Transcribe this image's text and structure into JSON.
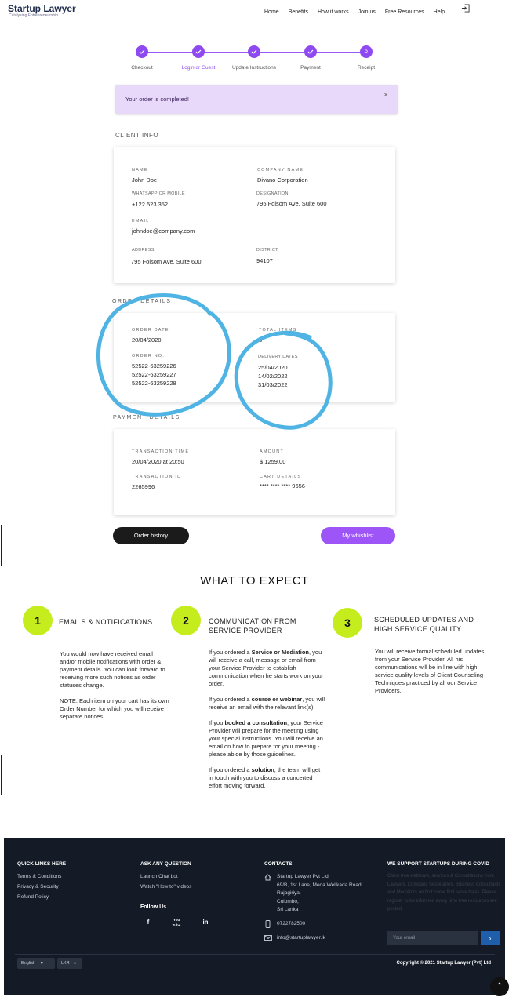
{
  "header": {
    "brand": "Startup Lawyer",
    "tagline": "Catalysing Entrepreneurship",
    "nav": [
      "Home",
      "Benefits",
      "How it works",
      "Join us",
      "Free Resources",
      "Help"
    ]
  },
  "steps": [
    {
      "label": "Checkout",
      "state": "done"
    },
    {
      "label": "Login or Guest",
      "state": "done"
    },
    {
      "label": "Update Instructions",
      "state": "done"
    },
    {
      "label": "Payment",
      "state": "done"
    },
    {
      "label": "Receipt",
      "state": "current",
      "number": "5"
    }
  ],
  "alert": {
    "message": "Your order is completed!",
    "close": "×"
  },
  "client_info": {
    "title": "CLIENT INFO",
    "name_label": "NAME",
    "name": "John Doe",
    "company_label": "COMPANY NAME",
    "company": "Divano Corporation",
    "phone_label": "WHATSAPP OR MOBILE",
    "phone": "+122 523 352",
    "designation_label": "DESIGNATION",
    "designation": "795 Folsom Ave, Suite 600",
    "email_label": "EMAIL",
    "email": "johndoe@company.com",
    "address_label": "ADDRESS",
    "address": "795 Folsom Ave, Suite 600",
    "district_label": "DISTRICT",
    "district": "94107"
  },
  "order_details": {
    "title": "ORDER DETAILS",
    "date_label": "ORDER DATE",
    "date": "20/04/2020",
    "items_label": "TOTAL ITEMS",
    "items": "3",
    "orderno_label": "ORDER NO.",
    "order_numbers": [
      "52522-63259226",
      "52522-63259227",
      "52522-63259228"
    ],
    "delivery_label": "DELIVERY DATES",
    "delivery_dates": [
      "25/04/2020",
      "14/02/2022",
      "31/03/2022"
    ]
  },
  "payment_details": {
    "title": "PAYMENT DETAILS",
    "time_label": "TRANSACTION TIME",
    "time": "20/04/2020 at 20:50",
    "amount_label": "AMOUNT",
    "amount": "$ 1259,00",
    "txid_label": "TRANSACTION ID",
    "txid": "2265996",
    "card_label": "CART DETAILS",
    "card": "**** **** **** 9656"
  },
  "buttons": {
    "order_history": "Order history",
    "wishlist": "My whishlist"
  },
  "what_to_expect": {
    "title": "WHAT TO EXPECT",
    "columns": [
      {
        "number": "1",
        "title": "EMAILS & NOTIFICATIONS",
        "paragraphs": [
          "You would now have received email and/or mobile notifications with order & payment details. You can look forward to receiving more such notices as order statuses change.",
          "NOTE: Each item on your cart has its own Order Number for which you will receive separate notices."
        ]
      },
      {
        "number": "2",
        "title": "COMMUNICATION FROM SERVICE PROVIDER",
        "p1_a": "If you ordered a ",
        "p1_b": "Service or Mediation",
        "p1_c": ", you will receive a call, message or email from your Service Provider to establish communication when he starts work on your order.",
        "p2_a": "If you ordered a ",
        "p2_b": "course or webinar",
        "p2_c": ", you will receive an email with the relevant link(s).",
        "p3_a": "If you ",
        "p3_b": "booked a consultation",
        "p3_c": ", your Service Provider will prepare for the meeting using your special instructions. You will receive an email on how to prepare for your meeting - please abide by those guidelines.",
        "p4_a": "If you ordered a ",
        "p4_b": "solution",
        "p4_c": ", the team will get in touch with you to discuss a concerted effort moving forward."
      },
      {
        "number": "3",
        "title": "SCHEDULED UPDATES AND HIGH SERVICE QUALITY",
        "paragraphs": [
          "You will receive formal scheduled updates from your Service Provider. All his communications will be in line with high service quality levels of Client Counseling Techniques practiced by all our Service Providers."
        ]
      }
    ]
  },
  "footer": {
    "quick_links_title": "QUICK LINKS HERE",
    "quick_links": [
      "Terms & Conditions",
      "Privacy & Security",
      "Refund Policy"
    ],
    "ask_title": "ASK ANY QUESTION",
    "ask_links": [
      "Launch Chat bot",
      "Watch \"How to\" videos"
    ],
    "follow_title": "Follow Us",
    "social": [
      "f",
      "You Tube",
      "in"
    ],
    "contacts_title": "CONTACTS",
    "address_lines": [
      "Startup Lawyer Pvt Ltd",
      "69/B, 1st Lane, Meda Welikada Road,",
      "Rajagiriya,",
      "Colombo,",
      "Sri Lanka"
    ],
    "phone": "0722782500",
    "email": "info@startuplawyer.lk",
    "covid_title": "WE SUPPORT STARTUPS DURING COVID",
    "covid_text": "Claim free webinars, services & Consultations from Lawyers, Company Secretaries, Business Consultants and Mediators on first come first serve basis. Please register to be informed every time free resources are posted.",
    "email_placeholder": "Your email",
    "language": "English",
    "currency": "LKR",
    "copyright": "Copyright © 2021 Startup Lawyer (Pvt) Ltd"
  }
}
